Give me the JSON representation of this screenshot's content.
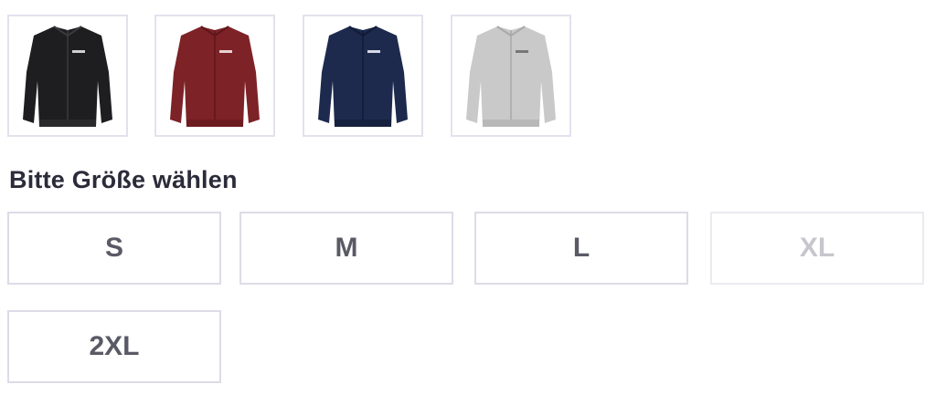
{
  "colors": {
    "options": [
      {
        "name": "schwarz",
        "hex": "#1e1e20",
        "icon": "jacket-black-image"
      },
      {
        "name": "bordeaux",
        "hex": "#7d2227",
        "icon": "jacket-red-image"
      },
      {
        "name": "navy",
        "hex": "#1d2a4d",
        "icon": "jacket-navy-image"
      },
      {
        "name": "grau",
        "hex": "#c9c9c9",
        "icon": "jacket-grey-image"
      }
    ]
  },
  "size_section": {
    "heading": "Bitte Größe wählen",
    "sizes": [
      {
        "label": "S",
        "available": true
      },
      {
        "label": "M",
        "available": true
      },
      {
        "label": "L",
        "available": true
      },
      {
        "label": "XL",
        "available": false
      },
      {
        "label": "2XL",
        "available": true
      }
    ]
  }
}
